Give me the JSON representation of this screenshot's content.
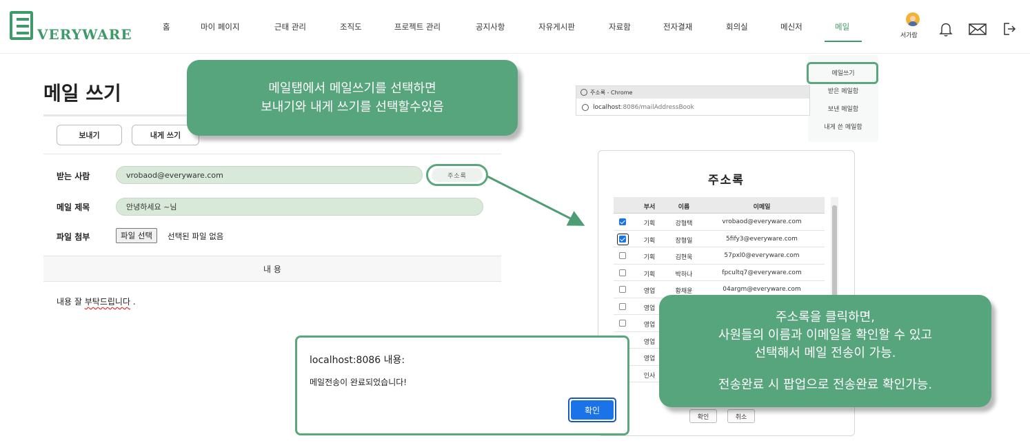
{
  "header": {
    "logo_text": "VERYWARE",
    "nav": [
      "홈",
      "마이 페이지",
      "근태 관리",
      "조직도",
      "프로젝트 관리",
      "공지사항",
      "자유게시판",
      "자료함",
      "전자결재",
      "회의실",
      "메신저",
      "메일"
    ],
    "active_nav": "메일",
    "user_name": "서가람",
    "accent_color": "#3f9a6a",
    "icons": [
      "bell-icon",
      "mail-icon",
      "logout-icon"
    ]
  },
  "mail_menu": {
    "items": [
      "메일쓰기",
      "받은 메일함",
      "보낸 메일함",
      "내게 쓴 메일함"
    ],
    "highlighted": "메일쓰기"
  },
  "compose": {
    "title": "메일 쓰기",
    "send_label": "보내기",
    "self_label": "내게 쓰기",
    "to_label": "받는 사람",
    "to_value": "vrobaod@everyware.com",
    "address_book_label": "주소록",
    "subject_label": "메일 제목",
    "subject_value": "안녕하세요 ~님",
    "attach_label": "파일 첨부",
    "file_button": "파일 선택",
    "file_status": "선택된 파일 없음",
    "content_header": "내   용",
    "content_body_prefix": "내용 잘 ",
    "content_body_underlined": "부탁드립니다",
    "content_body_suffix": " ."
  },
  "callout1": {
    "line1": "메일탭에서 메일쓰기를 선택하면",
    "line2": "보내기와 내게 쓰기를 선택할수있음"
  },
  "popup_window": {
    "title": "주소록 - Chrome",
    "url_host": "localhost",
    "url_rest": ":8086/mailAddressBook"
  },
  "address_book": {
    "title": "주소록",
    "columns": [
      "부서",
      "이름",
      "이메일"
    ],
    "rows": [
      {
        "dept": "기획",
        "name": "강형택",
        "email": "vrobaod@everyware.com",
        "checked": true
      },
      {
        "dept": "기획",
        "name": "장형일",
        "email": "5fify3@everyware.com",
        "checked": true
      },
      {
        "dept": "기획",
        "name": "김현욱",
        "email": "57pxl0@everyware.com",
        "checked": false
      },
      {
        "dept": "기획",
        "name": "박하나",
        "email": "fpcultq7@everyware.com",
        "checked": false
      },
      {
        "dept": "영업",
        "name": "황채윤",
        "email": "04argm@everyware.com",
        "checked": false
      },
      {
        "dept": "영업",
        "name": "",
        "email": "",
        "checked": false
      },
      {
        "dept": "영업",
        "name": "",
        "email": "",
        "checked": false
      },
      {
        "dept": "영업",
        "name": "",
        "email": "",
        "checked": false
      },
      {
        "dept": "영업",
        "name": "",
        "email": "",
        "checked": false
      },
      {
        "dept": "인사",
        "name": "",
        "email": "",
        "checked": false
      }
    ],
    "confirm_label": "확인",
    "cancel_label": "취소"
  },
  "callout2": {
    "line1": "주소록을 클릭하면,",
    "line2": "사원들의 이름과 이메일을 확인할 수 있고",
    "line3": "선택해서 메일 전송이 가능.",
    "line4": "전송완료 시 팝업으로 전송완료 확인가능."
  },
  "alert": {
    "title": "localhost:8086 내용:",
    "message": "메일전송이 완료되었습니다!",
    "ok_label": "확인"
  }
}
